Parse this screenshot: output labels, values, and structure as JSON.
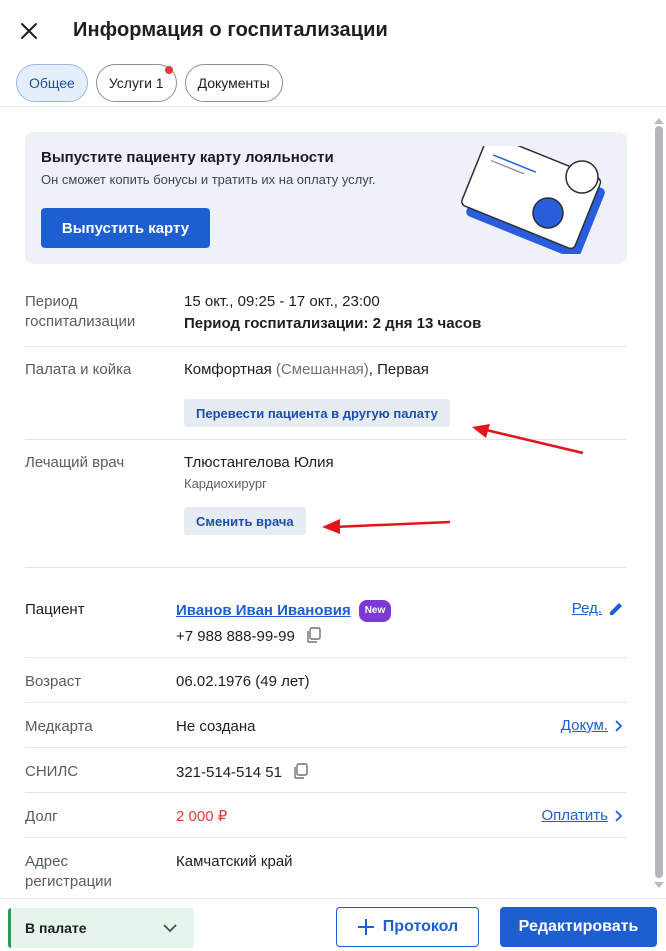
{
  "header": {
    "title": "Информация о госпитализации",
    "tabs": [
      {
        "label": "Общее",
        "active": true
      },
      {
        "label": "Услуги 1",
        "has_dot": true
      },
      {
        "label": "Документы"
      }
    ]
  },
  "promo": {
    "title": "Выпустите пациенту карту лояльности",
    "subtitle": "Он сможет копить бонусы и тратить их на оплату услуг.",
    "button_label": "Выпустить карту"
  },
  "hospitalization": {
    "period_label": "Период госпитализации",
    "period_value": "15 окт., 09:25 - 17 окт., 23:00",
    "period_duration": "Период госпитализации: 2 дня 13 часов",
    "ward_label": "Палата и койка",
    "ward_name": "Комфортная",
    "ward_type": "(Смешанная)",
    "ward_bed": ", Первая",
    "transfer_button": "Перевести пациента в другую палату",
    "doctor_label": "Лечащий врач",
    "doctor_name": "Тлюстангелова Юлия",
    "doctor_specialty": "Кардиохирург",
    "change_doctor_button": "Сменить врача"
  },
  "patient": {
    "label": "Пациент",
    "name": "Иванов Иван Ивановия",
    "badge": "New",
    "phone": "+7 988 888-99-99",
    "edit_link": "Ред.",
    "age_label": "Возраст",
    "age_value": "06.02.1976 (49 лет)",
    "medcard_label": "Медкарта",
    "medcard_value": "Не создана",
    "medcard_link": "Докум.",
    "snils_label": "СНИЛС",
    "snils_value": "321-514-514 51",
    "debt_label": "Долг",
    "debt_value": "2 000 ₽",
    "debt_link": "Оплатить",
    "address_label": "Адрес регистрации",
    "address_value": "Камчатский край"
  },
  "footer": {
    "status": "В палате",
    "protocol_button": "Протокол",
    "edit_button": "Редактировать"
  },
  "colors": {
    "primary": "#1d5fd0",
    "debt": "#e53935",
    "badge": "#7b39d6",
    "status_bg": "#e6f4ec",
    "annotation_arrow": "#e3141b"
  }
}
